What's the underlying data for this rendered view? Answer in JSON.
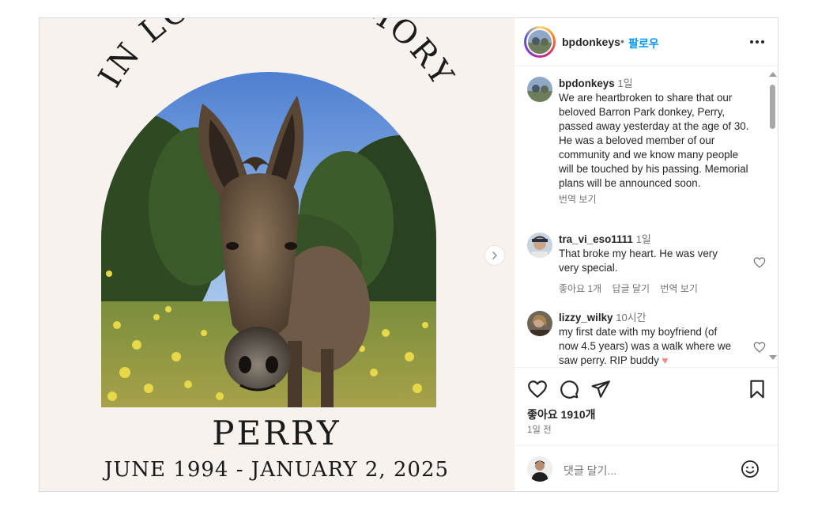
{
  "post": {
    "image": {
      "arc_text": "IN LOVING MEMORY",
      "name": "PERRY",
      "dates": "JUNE 1994 - JANUARY 2, 2025"
    }
  },
  "header": {
    "username": "bpdonkeys",
    "separator": "•",
    "follow_label": "팔로우",
    "more_icon": "more-horizontal-icon"
  },
  "caption": {
    "username": "bpdonkeys",
    "time": "1일",
    "text": "We are heartbroken to share that our beloved Barron Park donkey, Perry, passed away yesterday at the age of 30. He was a beloved member of our community and we know many people will be touched by his passing. Memorial plans will be announced soon.",
    "translate": "번역 보기"
  },
  "comments": [
    {
      "username": "tra_vi_eso1111",
      "time": "1일",
      "text": "That broke my heart. He was very very special.",
      "likes": "좋아요 1개",
      "reply": "답글 달기",
      "translate": "번역 보기"
    },
    {
      "username": "lizzy_wilky",
      "time": "10시간",
      "text": "my first date with my boyfriend (of now 4.5 years) was a walk where we saw perry. RIP buddy"
    }
  ],
  "actions": {
    "icons": [
      "heart-icon",
      "comment-icon",
      "share-icon",
      "bookmark-icon"
    ],
    "likes": "좋아요 1910개",
    "posted": "1일 전"
  },
  "add_comment": {
    "placeholder": "댓글 달기...",
    "emoji_icon": "emoji-icon"
  },
  "colors": {
    "accent": "#0095f6",
    "text": "#262626",
    "muted": "#737373",
    "memorial_bg": "#f8f2ee"
  }
}
